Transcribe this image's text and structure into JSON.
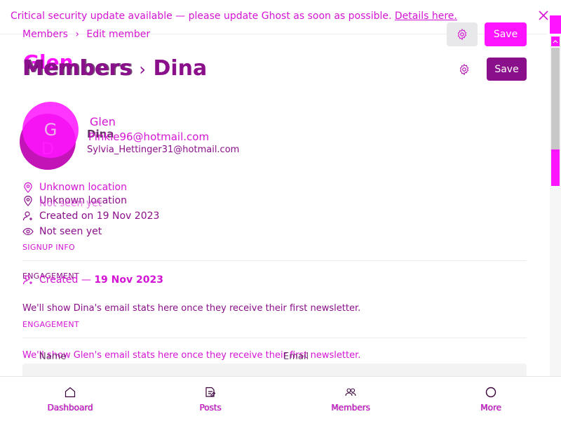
{
  "banner": {
    "text": "Critical security update available — please update Ghost as soon as possible.",
    "link": "Details here."
  },
  "breadcrumb": {
    "parent": "Members",
    "separator": "›",
    "current": "Edit member"
  },
  "toolbar": {
    "save_label": "Save",
    "save_label_2": "Save"
  },
  "page": {
    "title_ghost": "Glen",
    "title_ghost_2": "Members",
    "title_section": "Members",
    "title_chevron": "›",
    "title_name": "Dina"
  },
  "member": {
    "avatar_d": "D",
    "avatar_g": "G",
    "name_glen": "Glen",
    "name_dina": "Dina",
    "email_glen": "Pinkie96@hotmail.com",
    "email_dina": "Sylvia_Hettinger31@hotmail.com"
  },
  "details": {
    "location_1": "Unknown location",
    "location_2": "Unknown location",
    "seen_ghost": "Not seen yet",
    "created": "Created on 19 Nov 2023",
    "seen": "Not seen yet"
  },
  "sections": {
    "signup_info": "SIGNUP INFO",
    "engagement_1": "ENGAGEMENT",
    "created_prefix": "Created —",
    "created_date": "19 Nov 2023",
    "msg_dina": "We'll show Dina's email stats here once they receive their first newsletter.",
    "engagement_2": "ENGAGEMENT",
    "msg_glen": "We'll show Glen's email stats here once they receive their first newsletter.",
    "col_name": "Name",
    "col_email": "Email"
  },
  "nav": {
    "dashboard": "Dashboard",
    "posts": "Posts",
    "members": "Members",
    "more": "More"
  },
  "colors": {
    "accent": "#ff14ff",
    "primary": "#8a0f8a",
    "text_magenta": "#d414d4"
  }
}
